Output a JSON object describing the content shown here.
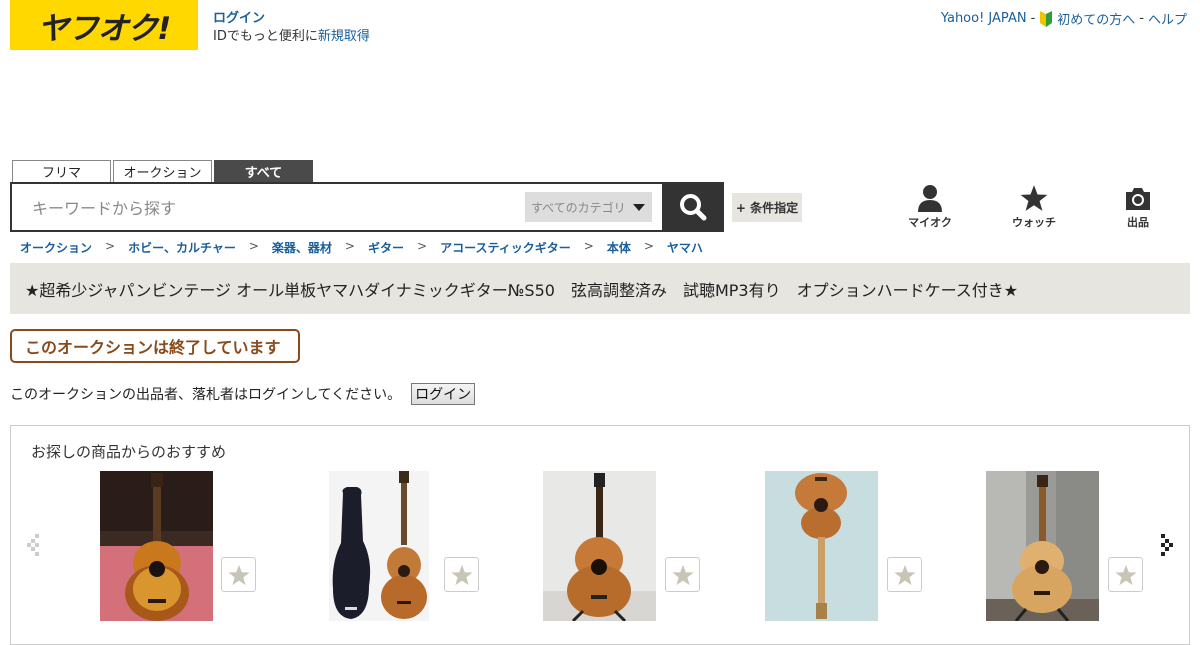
{
  "header": {
    "logo_text": "ヤフオク!",
    "login_link": "ログイン",
    "login_sub_prefix": "IDでもっと便利に",
    "register_link": "新規取得",
    "links": [
      "Yahoo! JAPAN",
      "初めての方へ",
      "ヘルプ"
    ],
    "sep": "-"
  },
  "search": {
    "tabs": [
      "フリマ",
      "オークション",
      "すべて"
    ],
    "active_tab": 2,
    "placeholder": "キーワードから探す",
    "category": "すべてのカテゴリ",
    "condition_label": "+ 条件指定"
  },
  "nav_icons": [
    {
      "label": "マイオク",
      "icon": "person-icon"
    },
    {
      "label": "ウォッチ",
      "icon": "star-icon"
    },
    {
      "label": "出品",
      "icon": "camera-icon"
    }
  ],
  "breadcrumb": [
    "オークション",
    "ホビー、カルチャー",
    "楽器、器材",
    "ギター",
    "アコースティックギター",
    "本体",
    "ヤマハ"
  ],
  "breadcrumb_sep": ">",
  "item": {
    "title": "★超希少ジャパンビンテージ オール単板ヤマハダイナミックギター№S50　弦高調整済み　試聴MP3有り　オプションハードケース付き★",
    "ended_text": "このオークションは終了しています",
    "login_note": "このオークションの出品者、落札者はログインしてください。",
    "login_button": "ログイン"
  },
  "recommend": {
    "title": "お探しの商品からのおすすめ",
    "items": [
      {
        "icon": "classical-guitar-sunburst-image"
      },
      {
        "icon": "guitar-with-gigbag-image"
      },
      {
        "icon": "acoustic-guitar-on-stand-image"
      },
      {
        "icon": "acoustic-guitar-flat-image"
      },
      {
        "icon": "acoustic-guitar-by-fridge-image"
      }
    ]
  },
  "colors": {
    "brand_yellow": "#ffd800",
    "link_blue": "#1a5e9c",
    "ended_brown": "#8a4a1c",
    "panel_bg": "#e6e5e0"
  }
}
